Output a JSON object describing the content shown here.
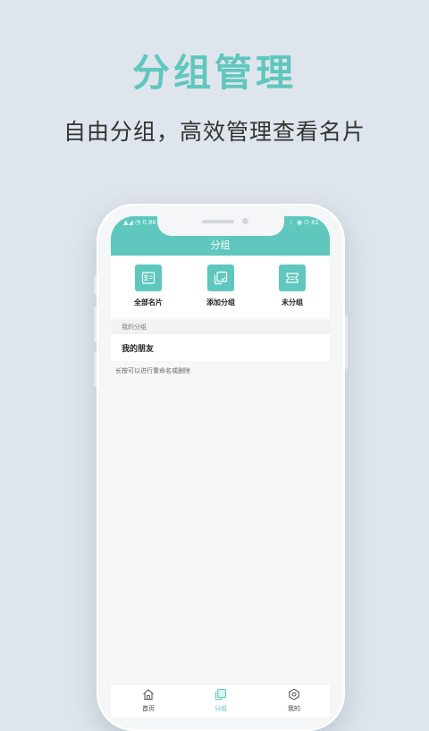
{
  "promo": {
    "title": "分组管理",
    "subtitle": "自由分组，高效管理查看名片"
  },
  "status_bar": {
    "left_text": "▲◢ ◔ 0.8K",
    "right_text": "☾ ◉ ⏻ 81"
  },
  "app": {
    "title": "分组",
    "accent_color": "#5fc7bd",
    "actions": [
      {
        "label": "全部名片",
        "icon": "contact-card-icon"
      },
      {
        "label": "添加分组",
        "icon": "add-group-icon"
      },
      {
        "label": "未分组",
        "icon": "ungrouped-icon"
      }
    ],
    "section_header": "我的分组",
    "groups": [
      {
        "name": "我的朋友"
      }
    ],
    "hint": "长按可以进行重命名或删除",
    "tabs": [
      {
        "label": "首页",
        "icon": "home-icon",
        "active": false
      },
      {
        "label": "分组",
        "icon": "group-icon",
        "active": true
      },
      {
        "label": "我的",
        "icon": "profile-icon",
        "active": false
      }
    ]
  }
}
